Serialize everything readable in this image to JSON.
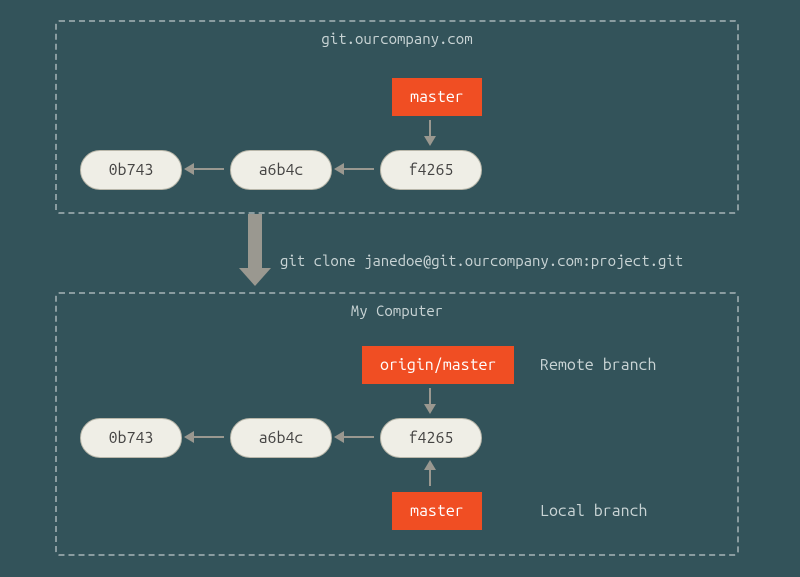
{
  "remote": {
    "title": "git.ourcompany.com",
    "commits": [
      "0b743",
      "a6b4c",
      "f4265"
    ],
    "branch": "master"
  },
  "clone_command": "git clone janedoe@git.ourcompany.com:project.git",
  "local": {
    "title": "My Computer",
    "commits": [
      "0b743",
      "a6b4c",
      "f4265"
    ],
    "remote_branch": "origin/master",
    "remote_branch_label": "Remote branch",
    "local_branch": "master",
    "local_branch_label": "Local branch"
  }
}
